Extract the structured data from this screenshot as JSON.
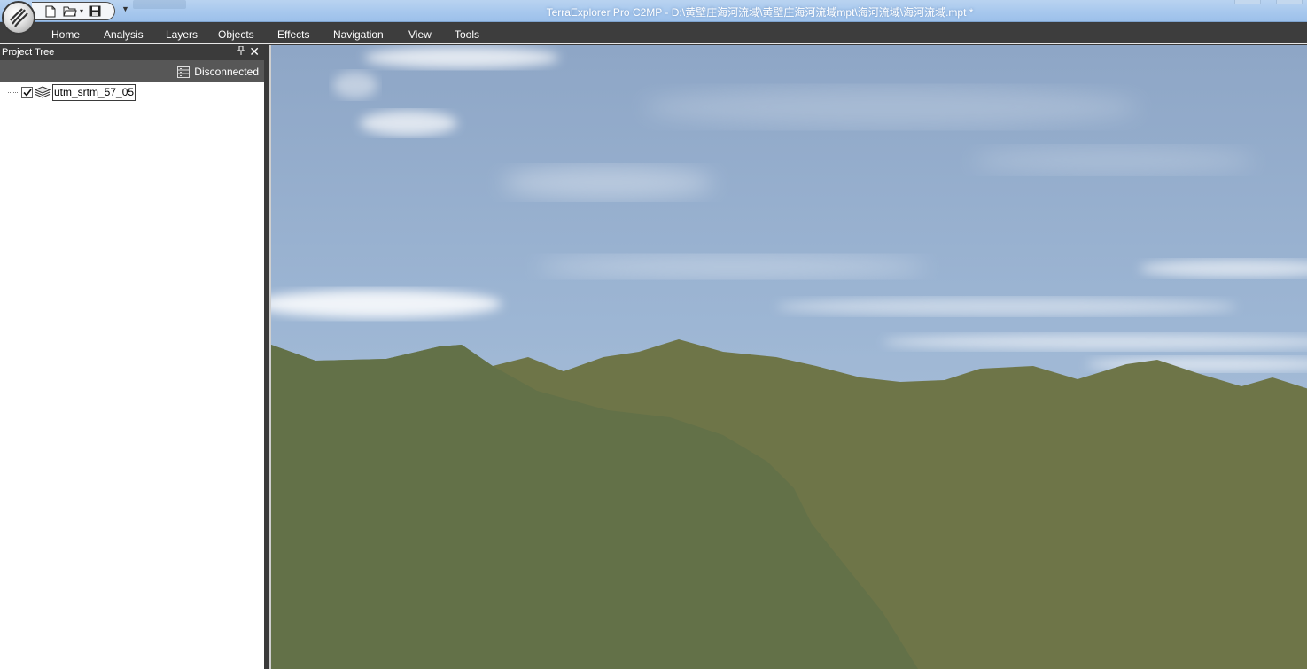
{
  "window": {
    "title": "TerraExplorer Pro C2MP - D:\\黄壁庄海河流域\\黄壁庄海河流域mpt\\海河流域\\海河流域.mpt *"
  },
  "quick_access": {
    "icons": [
      "new-file-icon",
      "open-folder-icon",
      "dropdown-arrow-icon",
      "save-icon",
      "customize-dropdown-icon"
    ]
  },
  "ribbon": {
    "tabs": [
      {
        "label": "Home"
      },
      {
        "label": "Analysis"
      },
      {
        "label": "Layers"
      },
      {
        "label": "Objects"
      },
      {
        "label": "Effects"
      },
      {
        "label": "Navigation"
      },
      {
        "label": "View"
      },
      {
        "label": "Tools"
      }
    ]
  },
  "project_tree": {
    "title": "Project Tree",
    "status": "Disconnected",
    "items": [
      {
        "label": "utm_srtm_57_05",
        "checked": true,
        "icon": "terrain-layer-icon"
      }
    ]
  },
  "colors": {
    "dark_chrome": "#3b3b3b",
    "title_gradient": "#a9c9ee",
    "terrain": "#66744a",
    "sky": "#9bb4d2"
  }
}
